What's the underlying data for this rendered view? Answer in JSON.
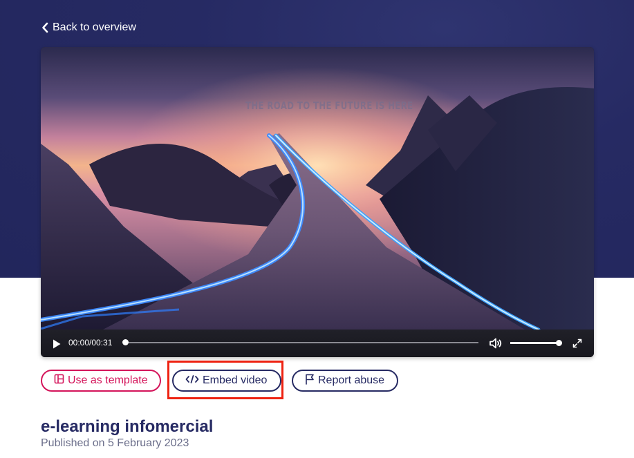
{
  "nav": {
    "back_label": "Back to overview"
  },
  "video": {
    "caption": "THE ROAD TO THE FUTURE IS HERE",
    "time_display": "00:00/00:31",
    "progress": 0,
    "volume": 1.0
  },
  "actions": {
    "use_template_label": "Use as template",
    "embed_label": "Embed video",
    "report_label": "Report abuse"
  },
  "details": {
    "title": "e-learning infomercial",
    "published": "Published on 5 February 2023"
  },
  "colors": {
    "hero_background": "#262a63",
    "accent_pink": "#d4145a",
    "navy": "#262a63",
    "highlight": "#ee2211"
  },
  "icons": {
    "back": "chevron-left-icon",
    "play": "play-icon",
    "volume": "volume-icon",
    "fullscreen": "fullscreen-icon",
    "template": "layout-template-icon",
    "embed": "code-icon",
    "report": "flag-icon"
  }
}
